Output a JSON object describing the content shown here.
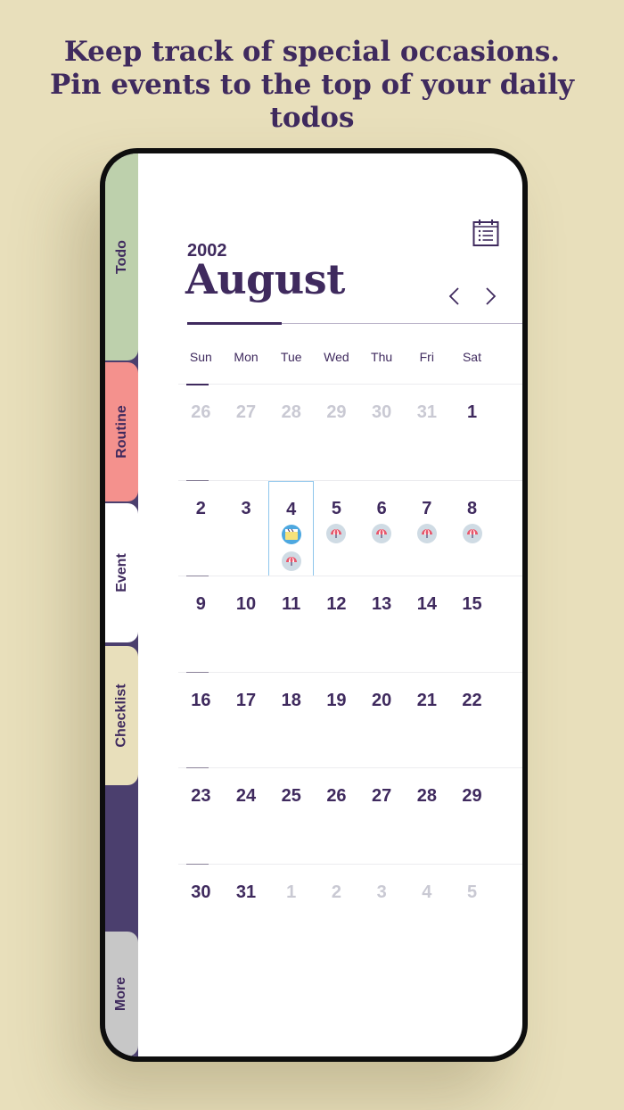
{
  "headline": {
    "line1": "Keep track of special occasions.",
    "line2": "Pin events to the top of your daily",
    "line3": "todos"
  },
  "tabs": [
    {
      "id": "todo",
      "label": "Todo"
    },
    {
      "id": "routine",
      "label": "Routine"
    },
    {
      "id": "event",
      "label": "Event",
      "active": true
    },
    {
      "id": "checklist",
      "label": "Checklist"
    },
    {
      "id": "more",
      "label": "More"
    }
  ],
  "calendar": {
    "year": "2002",
    "month": "August",
    "weekdays": [
      "Sun",
      "Mon",
      "Tue",
      "Wed",
      "Thu",
      "Fri",
      "Sat"
    ],
    "weeks": [
      [
        {
          "d": "26",
          "m": true
        },
        {
          "d": "27",
          "m": true
        },
        {
          "d": "28",
          "m": true
        },
        {
          "d": "29",
          "m": true
        },
        {
          "d": "30",
          "m": true
        },
        {
          "d": "31",
          "m": true
        },
        {
          "d": "1"
        }
      ],
      [
        {
          "d": "2"
        },
        {
          "d": "3"
        },
        {
          "d": "4",
          "selected": true,
          "icons": [
            "clapper-icon",
            "umbrella-icon"
          ]
        },
        {
          "d": "5",
          "icons": [
            "umbrella-icon"
          ]
        },
        {
          "d": "6",
          "icons": [
            "umbrella-icon"
          ]
        },
        {
          "d": "7",
          "icons": [
            "umbrella-icon"
          ]
        },
        {
          "d": "8",
          "icons": [
            "umbrella-icon"
          ]
        }
      ],
      [
        {
          "d": "9"
        },
        {
          "d": "10"
        },
        {
          "d": "11"
        },
        {
          "d": "12"
        },
        {
          "d": "13"
        },
        {
          "d": "14"
        },
        {
          "d": "15"
        }
      ],
      [
        {
          "d": "16"
        },
        {
          "d": "17"
        },
        {
          "d": "18"
        },
        {
          "d": "19"
        },
        {
          "d": "20"
        },
        {
          "d": "21"
        },
        {
          "d": "22"
        }
      ],
      [
        {
          "d": "23"
        },
        {
          "d": "24"
        },
        {
          "d": "25"
        },
        {
          "d": "26"
        },
        {
          "d": "27"
        },
        {
          "d": "28"
        },
        {
          "d": "29"
        }
      ],
      [
        {
          "d": "30"
        },
        {
          "d": "31"
        },
        {
          "d": "1",
          "m": true
        },
        {
          "d": "2",
          "m": true
        },
        {
          "d": "3",
          "m": true
        },
        {
          "d": "4",
          "m": true
        },
        {
          "d": "5",
          "m": true
        }
      ]
    ]
  },
  "colors": {
    "background": "#e8dfbb",
    "primary_text": "#3f2a5e",
    "muted_text": "#c9c9d3",
    "tab_todo": "#bdd0ac",
    "tab_routine": "#f4918d",
    "tab_checklist": "#e8dfbb",
    "tab_more": "#c7c7c7",
    "rail": "#4b3f6e",
    "selected_border": "#8fc6ec"
  }
}
